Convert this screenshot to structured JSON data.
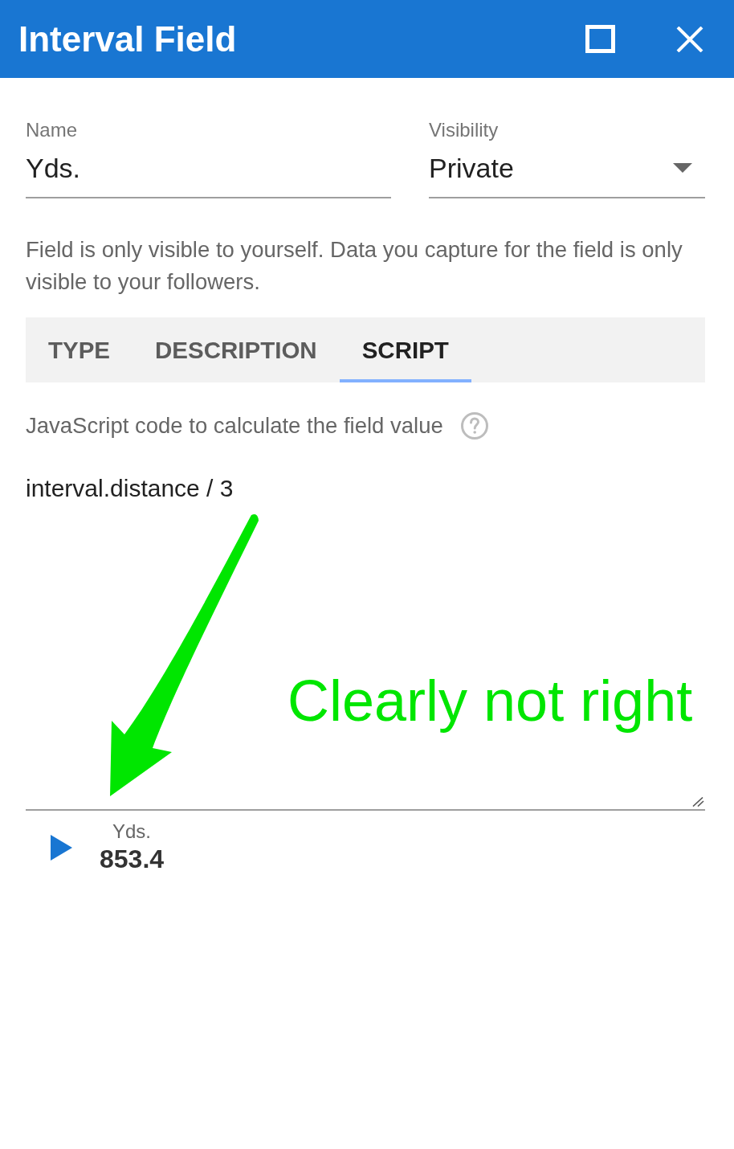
{
  "window": {
    "title": "Interval Field"
  },
  "name_field": {
    "label": "Name",
    "value": "Yds."
  },
  "visibility_field": {
    "label": "Visibility",
    "value": "Private"
  },
  "visibility_help": "Field is only visible to yourself. Data you capture for the field is only visible to your followers.",
  "tabs": [
    {
      "label": "TYPE",
      "selected": false
    },
    {
      "label": "DESCRIPTION",
      "selected": false
    },
    {
      "label": "SCRIPT",
      "selected": true
    }
  ],
  "script": {
    "label": "JavaScript code to calculate the field value",
    "code": "interval.distance / 3"
  },
  "result": {
    "label": "Yds.",
    "value": "853.4"
  },
  "annotation": {
    "text": "Clearly not right"
  }
}
